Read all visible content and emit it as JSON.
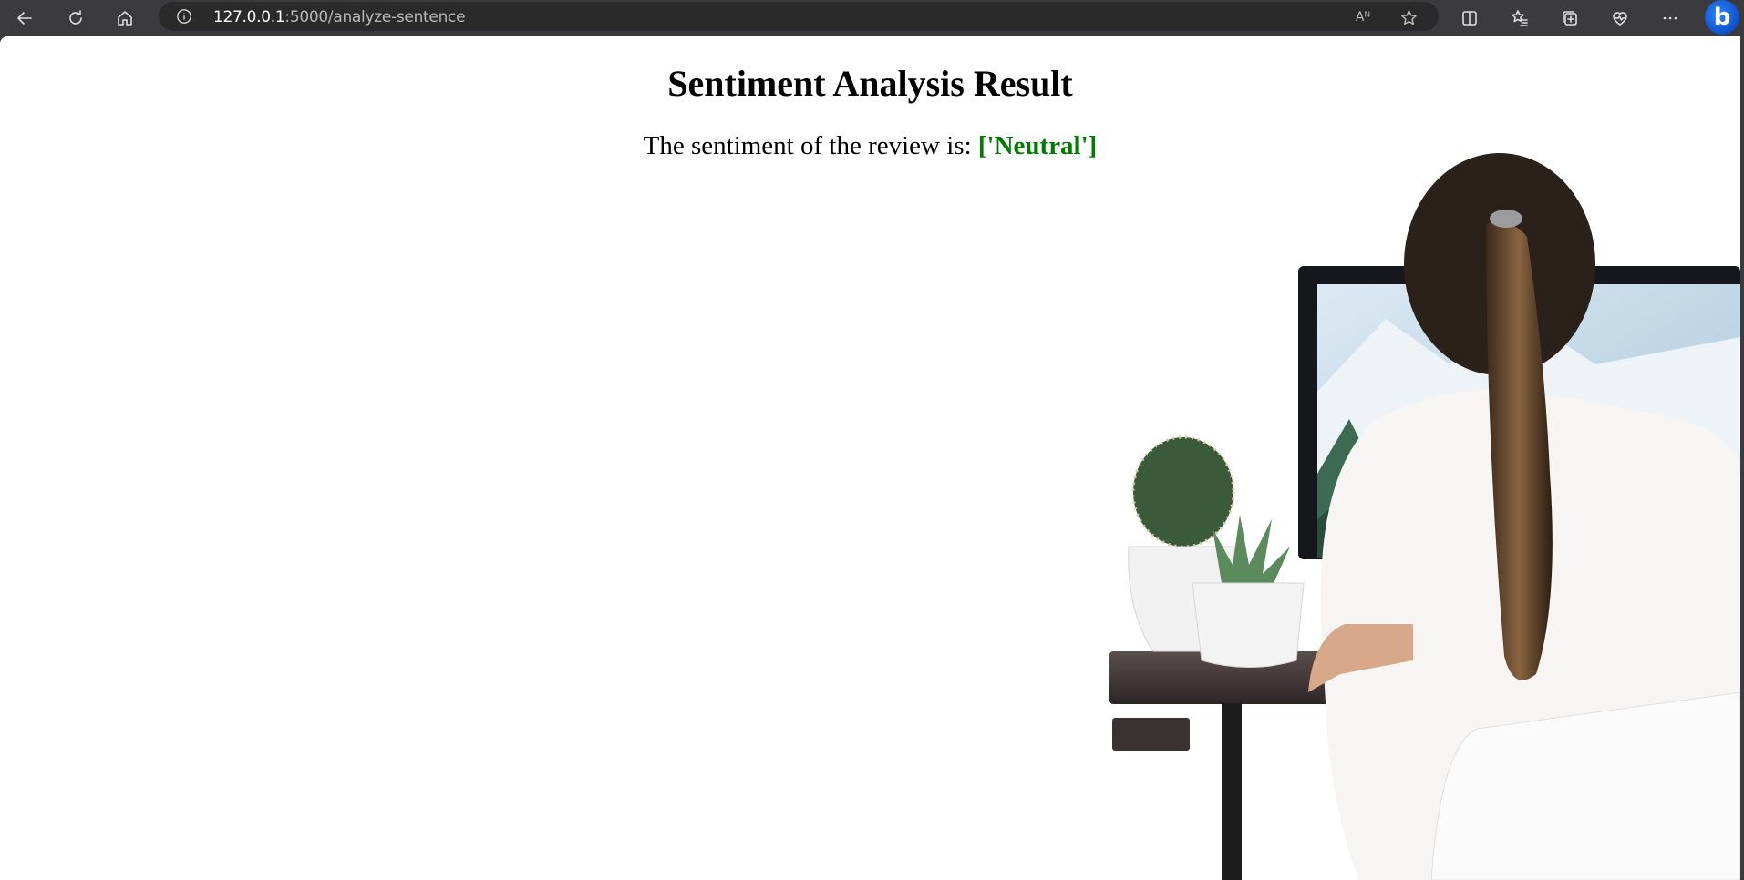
{
  "browser": {
    "url_host": "127.0.0.1",
    "url_rest": ":5000/analyze-sentence",
    "read_aloud_glyph": "Aᴺ",
    "bing_letter": "b",
    "icons": [
      "back-icon",
      "refresh-icon",
      "home-icon",
      "info-icon",
      "read-aloud-icon",
      "favorite-star-icon",
      "split-screen-icon",
      "favorites-icon",
      "collections-icon",
      "browser-essentials-icon",
      "more-icon",
      "bing-copilot-icon"
    ]
  },
  "page": {
    "title": "Sentiment Analysis Result",
    "result_prefix": "The sentiment of the review is: ",
    "result_value": "['Neutral']",
    "result_color": "#007a00"
  }
}
